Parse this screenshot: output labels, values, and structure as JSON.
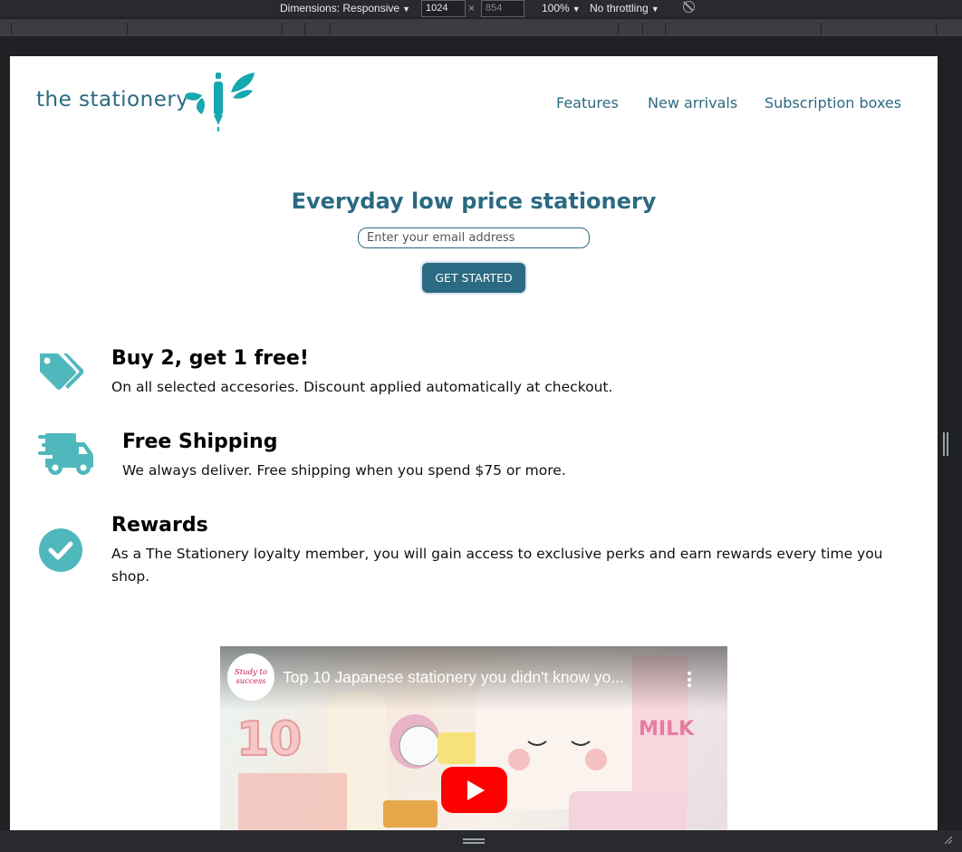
{
  "devtools": {
    "dimensions_label": "Dimensions: Responsive",
    "width_value": "1024",
    "height_placeholder": "854",
    "times": "×",
    "zoom": "100%",
    "throttling": "No throttling"
  },
  "header": {
    "logo_text": "the stationery",
    "nav": [
      "Features",
      "New arrivals",
      "Subscription boxes"
    ]
  },
  "hero": {
    "title": "Everyday low price stationery",
    "email_placeholder": "Enter your email address",
    "cta": "GET STARTED"
  },
  "features": [
    {
      "icon": "tags-icon",
      "title": "Buy 2, get 1 free!",
      "desc": "On all selected accesories. Discount applied automatically at checkout."
    },
    {
      "icon": "shipping-truck-icon",
      "title": "Free Shipping",
      "desc": "We always deliver. Free shipping when you spend $75 or more."
    },
    {
      "icon": "check-circle-icon",
      "title": "Rewards",
      "desc": "As a The Stationery loyalty member, you will gain access to exclusive perks and earn rewards every time you shop."
    }
  ],
  "video": {
    "title": "Top 10 Japanese stationery you didn't know yo...",
    "channel_logo": "Study to success"
  },
  "colors": {
    "brand": "#2b6a82",
    "icon_teal": "#4fb8bd",
    "logo_teal": "#15a8b0"
  }
}
